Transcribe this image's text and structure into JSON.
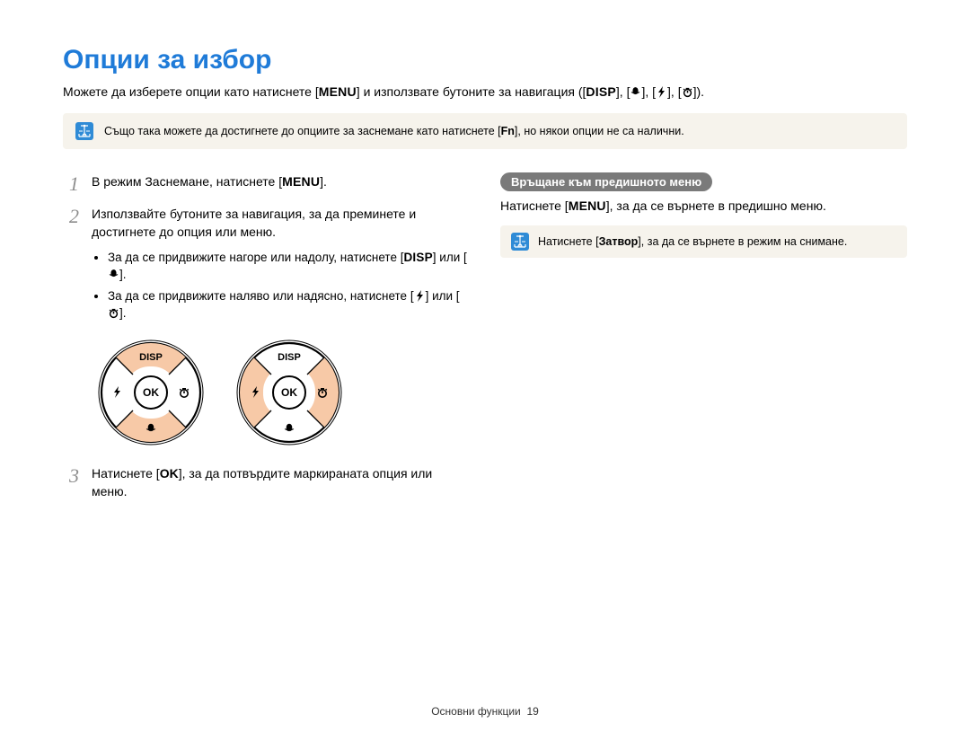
{
  "title": "Опции за избор",
  "intro": {
    "p1": "Можете да изберете опции като натиснете [",
    "p2": "] и използвате бутоните за навигация ([",
    "p3": "], [",
    "p4": "], [",
    "p5": "], [",
    "p6": "]).",
    "menu": "MENU",
    "disp": "DISP"
  },
  "infobar": {
    "t1": "Също така можете да достигнете до опциите за заснемане като натиснете [",
    "fn": "Fn",
    "t2": "], но някои опции не са налични."
  },
  "steps": {
    "s1": {
      "t1": "В режим Заснемане, натиснете [",
      "menu": "MENU",
      "t2": "]."
    },
    "s2": {
      "t": "Използвайте бутоните за навигация, за да преминете и достигнете до опция или меню.",
      "b1a": "За да се придвижите нагоре или надолу, натиснете [",
      "disp": "DISP",
      "b1b": "] или [",
      "b1c": "].",
      "b2a": "За да се придвижите наляво или надясно, натиснете [",
      "b2b": "] или [",
      "b2c": "]."
    },
    "s3": {
      "t1": "Натиснете [",
      "ok": "OK",
      "t2": "], за да потвърдите маркираната опция или меню."
    }
  },
  "dial": {
    "disp": "DISP",
    "ok": "OK"
  },
  "right": {
    "heading": "Връщане към предишното меню",
    "t1": "Натиснете [",
    "menu": "MENU",
    "t2": "], за да се върнете в предишно меню.",
    "noteA": "Натиснете [",
    "noteBold": "Затвор",
    "noteB": "], за да се върнете в режим на снимане."
  },
  "footer": {
    "section": "Основни функции",
    "page": "19"
  }
}
